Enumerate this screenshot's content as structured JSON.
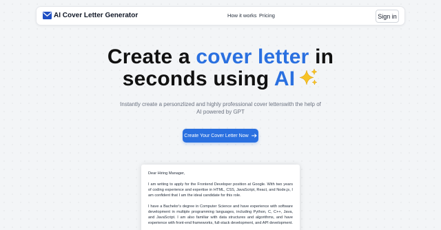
{
  "nav": {
    "brand": "AI Cover Letter Generator",
    "links": [
      "How it works",
      "Pricing"
    ],
    "signin": "Sign in"
  },
  "hero": {
    "title_line1_before": "Create a ",
    "title_line1_accent": "cover letter",
    "title_line1_after": " in",
    "title_line2_before": "seconds using ",
    "title_line2_accent": "AI",
    "subtitle": "Instantly create a personzlized and highly professional cover letterswith the help of AI powered by GPT",
    "cta": "Create Your Cover Letter Now"
  },
  "letter": {
    "greeting": "Dear Hiring Manager,",
    "paragraphs": [
      "I am writing to apply for the Frontend Developer position at Google. With two years of coding experience and expertise in HTML, CSS, JavaScript, React, and Node.js, I am confident that I am the ideal candidate for this role.",
      "I have a Bachelor's degree in Computer Science and have experience with software development in multiple programming languages, including Python, C, C++, Java, and JavaScript. I am also familiar with data structures and algorithms, and have experience with front-end frameworks, full-stack development, and API development."
    ]
  },
  "colors": {
    "accent": "#2a70e0",
    "background": "#f3f5f7"
  },
  "icons": {
    "brand": "mail-icon",
    "title_emoji": "sparkles-icon",
    "cta": "arrow-right-icon"
  }
}
